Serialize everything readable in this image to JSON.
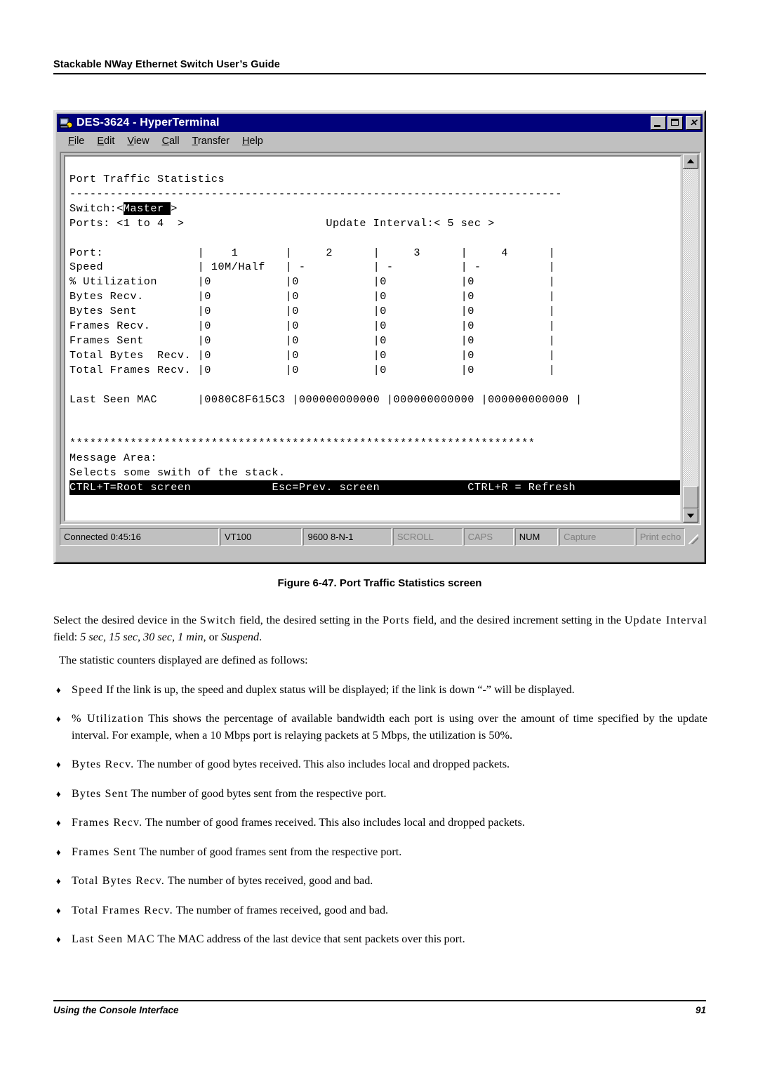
{
  "page": {
    "header_title": "Stackable NWay Ethernet Switch User’s Guide",
    "footer_left": "Using the Console Interface",
    "footer_page": "91"
  },
  "window": {
    "title": "DES-3624 - HyperTerminal",
    "icon": "hyperterminal-icon",
    "buttons": {
      "minimize": "_",
      "maximize": "□",
      "close": "✕"
    },
    "menu": [
      {
        "label": "File",
        "accel": "F"
      },
      {
        "label": "Edit",
        "accel": "E"
      },
      {
        "label": "View",
        "accel": "V"
      },
      {
        "label": "Call",
        "accel": "C"
      },
      {
        "label": "Transfer",
        "accel": "T"
      },
      {
        "label": "Help",
        "accel": "H"
      }
    ],
    "statusbar": {
      "connected": "Connected 0:45:16",
      "emulation": "VT100",
      "line_settings": "9600 8-N-1",
      "scroll": "SCROLL",
      "caps": "CAPS",
      "num": "NUM",
      "capture": "Capture",
      "print_echo": "Print echo"
    }
  },
  "terminal": {
    "title": "Port Traffic Statistics",
    "divider": "-------------------------------------------------------------------------",
    "switch_label": "Switch:<",
    "switch_value": "Master ",
    "switch_close": ">",
    "ports_line": "Ports: <1 to 4  >",
    "update_interval_label": "Update Interval:",
    "update_interval_value": "< 5 sec >",
    "columns": [
      "1",
      "2",
      "3",
      "4"
    ],
    "rows": [
      {
        "label": "Port:",
        "values": [
          "1",
          "2",
          "3",
          "4"
        ]
      },
      {
        "label": "Speed",
        "values": [
          "10M/Half",
          "-",
          "-",
          "-"
        ]
      },
      {
        "label": "% Utilization",
        "values": [
          "0",
          "0",
          "0",
          "0"
        ]
      },
      {
        "label": "Bytes Recv.",
        "values": [
          "0",
          "0",
          "0",
          "0"
        ]
      },
      {
        "label": "Bytes Sent",
        "values": [
          "0",
          "0",
          "0",
          "0"
        ]
      },
      {
        "label": "Frames Recv.",
        "values": [
          "0",
          "0",
          "0",
          "0"
        ]
      },
      {
        "label": "Frames Sent",
        "values": [
          "0",
          "0",
          "0",
          "0"
        ]
      },
      {
        "label": "Total Bytes  Recv.",
        "values": [
          "0",
          "0",
          "0",
          "0"
        ]
      },
      {
        "label": "Total Frames Recv.",
        "values": [
          "0",
          "0",
          "0",
          "0"
        ]
      },
      {
        "label": "Last Seen MAC",
        "values": [
          "0080C8F615C3",
          "000000000000",
          "000000000000",
          "000000000000"
        ]
      }
    ],
    "starline": "*********************************************************************",
    "message_area_label": "Message Area:",
    "message_text": "Selects some swith of the stack.",
    "status_left": "CTRL+T=Root screen",
    "status_mid": "Esc=Prev. screen",
    "status_right": "CTRL+R = Refresh",
    "screen_text": "Port Traffic Statistics\n-------------------------------------------------------------------------\nSwitch:<",
    "body_block": "Port:              |    1       |     2      |     3      |     4      |\nSpeed              | 10M/Half   | -          | -          | -          |\n% Utilization      |0           |0           |0           |0           |\nBytes Recv.        |0           |0           |0           |0           |\nBytes Sent         |0           |0           |0           |0           |\nFrames Recv.       |0           |0           |0           |0           |\nFrames Sent        |0           |0           |0           |0           |\nTotal Bytes  Recv. |0           |0           |0           |0           |\nTotal Frames Recv. |0           |0           |0           |0           |\n\nLast Seen MAC      |0080C8F615C3 |000000000000 |000000000000 |000000000000 |"
  },
  "figure": {
    "caption": "Figure 6-47.  Port Traffic Statistics screen"
  },
  "text": {
    "para1_a": "Select the desired device in the ",
    "para1_switch": "Switch",
    "para1_b": " field, the desired setting in the ",
    "para1_ports": "Ports",
    "para1_c": " field, and the desired increment setting in the ",
    "para1_update": "Update Interval",
    "para1_d": " field: ",
    "para1_options": "5 sec, 15 sec, 30 sec, 1 min",
    "para1_e": ", or ",
    "para1_suspend": "Suspend",
    "para1_f": ".",
    "para2": "The statistic counters displayed are defined as follows:",
    "bullet_char": "♦",
    "bullets": [
      {
        "term": "Speed",
        "desc": "  If the link is up, the speed and duplex status will be displayed; if the link is down “-” will be displayed."
      },
      {
        "term": "% Utilization",
        "desc": "  This shows the percentage of available bandwidth each port is using over the amount of time specified by the update interval. For example, when a 10 Mbps port is relaying packets at 5 Mbps, the utilization is 50%."
      },
      {
        "term": "Bytes Recv.",
        "desc": "  The number of good bytes received. This also includes local and dropped packets."
      },
      {
        "term": "Bytes Sent",
        "desc": "  The number of good bytes sent from the respective port."
      },
      {
        "term": "Frames Recv.",
        "desc": "  The number of good frames received. This also includes local and dropped packets."
      },
      {
        "term": "Frames Sent",
        "desc": "  The number of good frames sent from the respective port."
      },
      {
        "term": "Total Bytes Recv.",
        "desc": "  The number of bytes received, good and bad."
      },
      {
        "term": "Total Frames Recv.",
        "desc": "  The number of frames received, good and bad."
      },
      {
        "term": "Last Seen MAC",
        "desc": "  The MAC address of the last device that sent packets over this port."
      }
    ]
  },
  "colors": {
    "titlebar": "#00007b",
    "window_face": "#c0c0c0",
    "terminal_bg": "#ffffff",
    "terminal_fg": "#000000"
  }
}
